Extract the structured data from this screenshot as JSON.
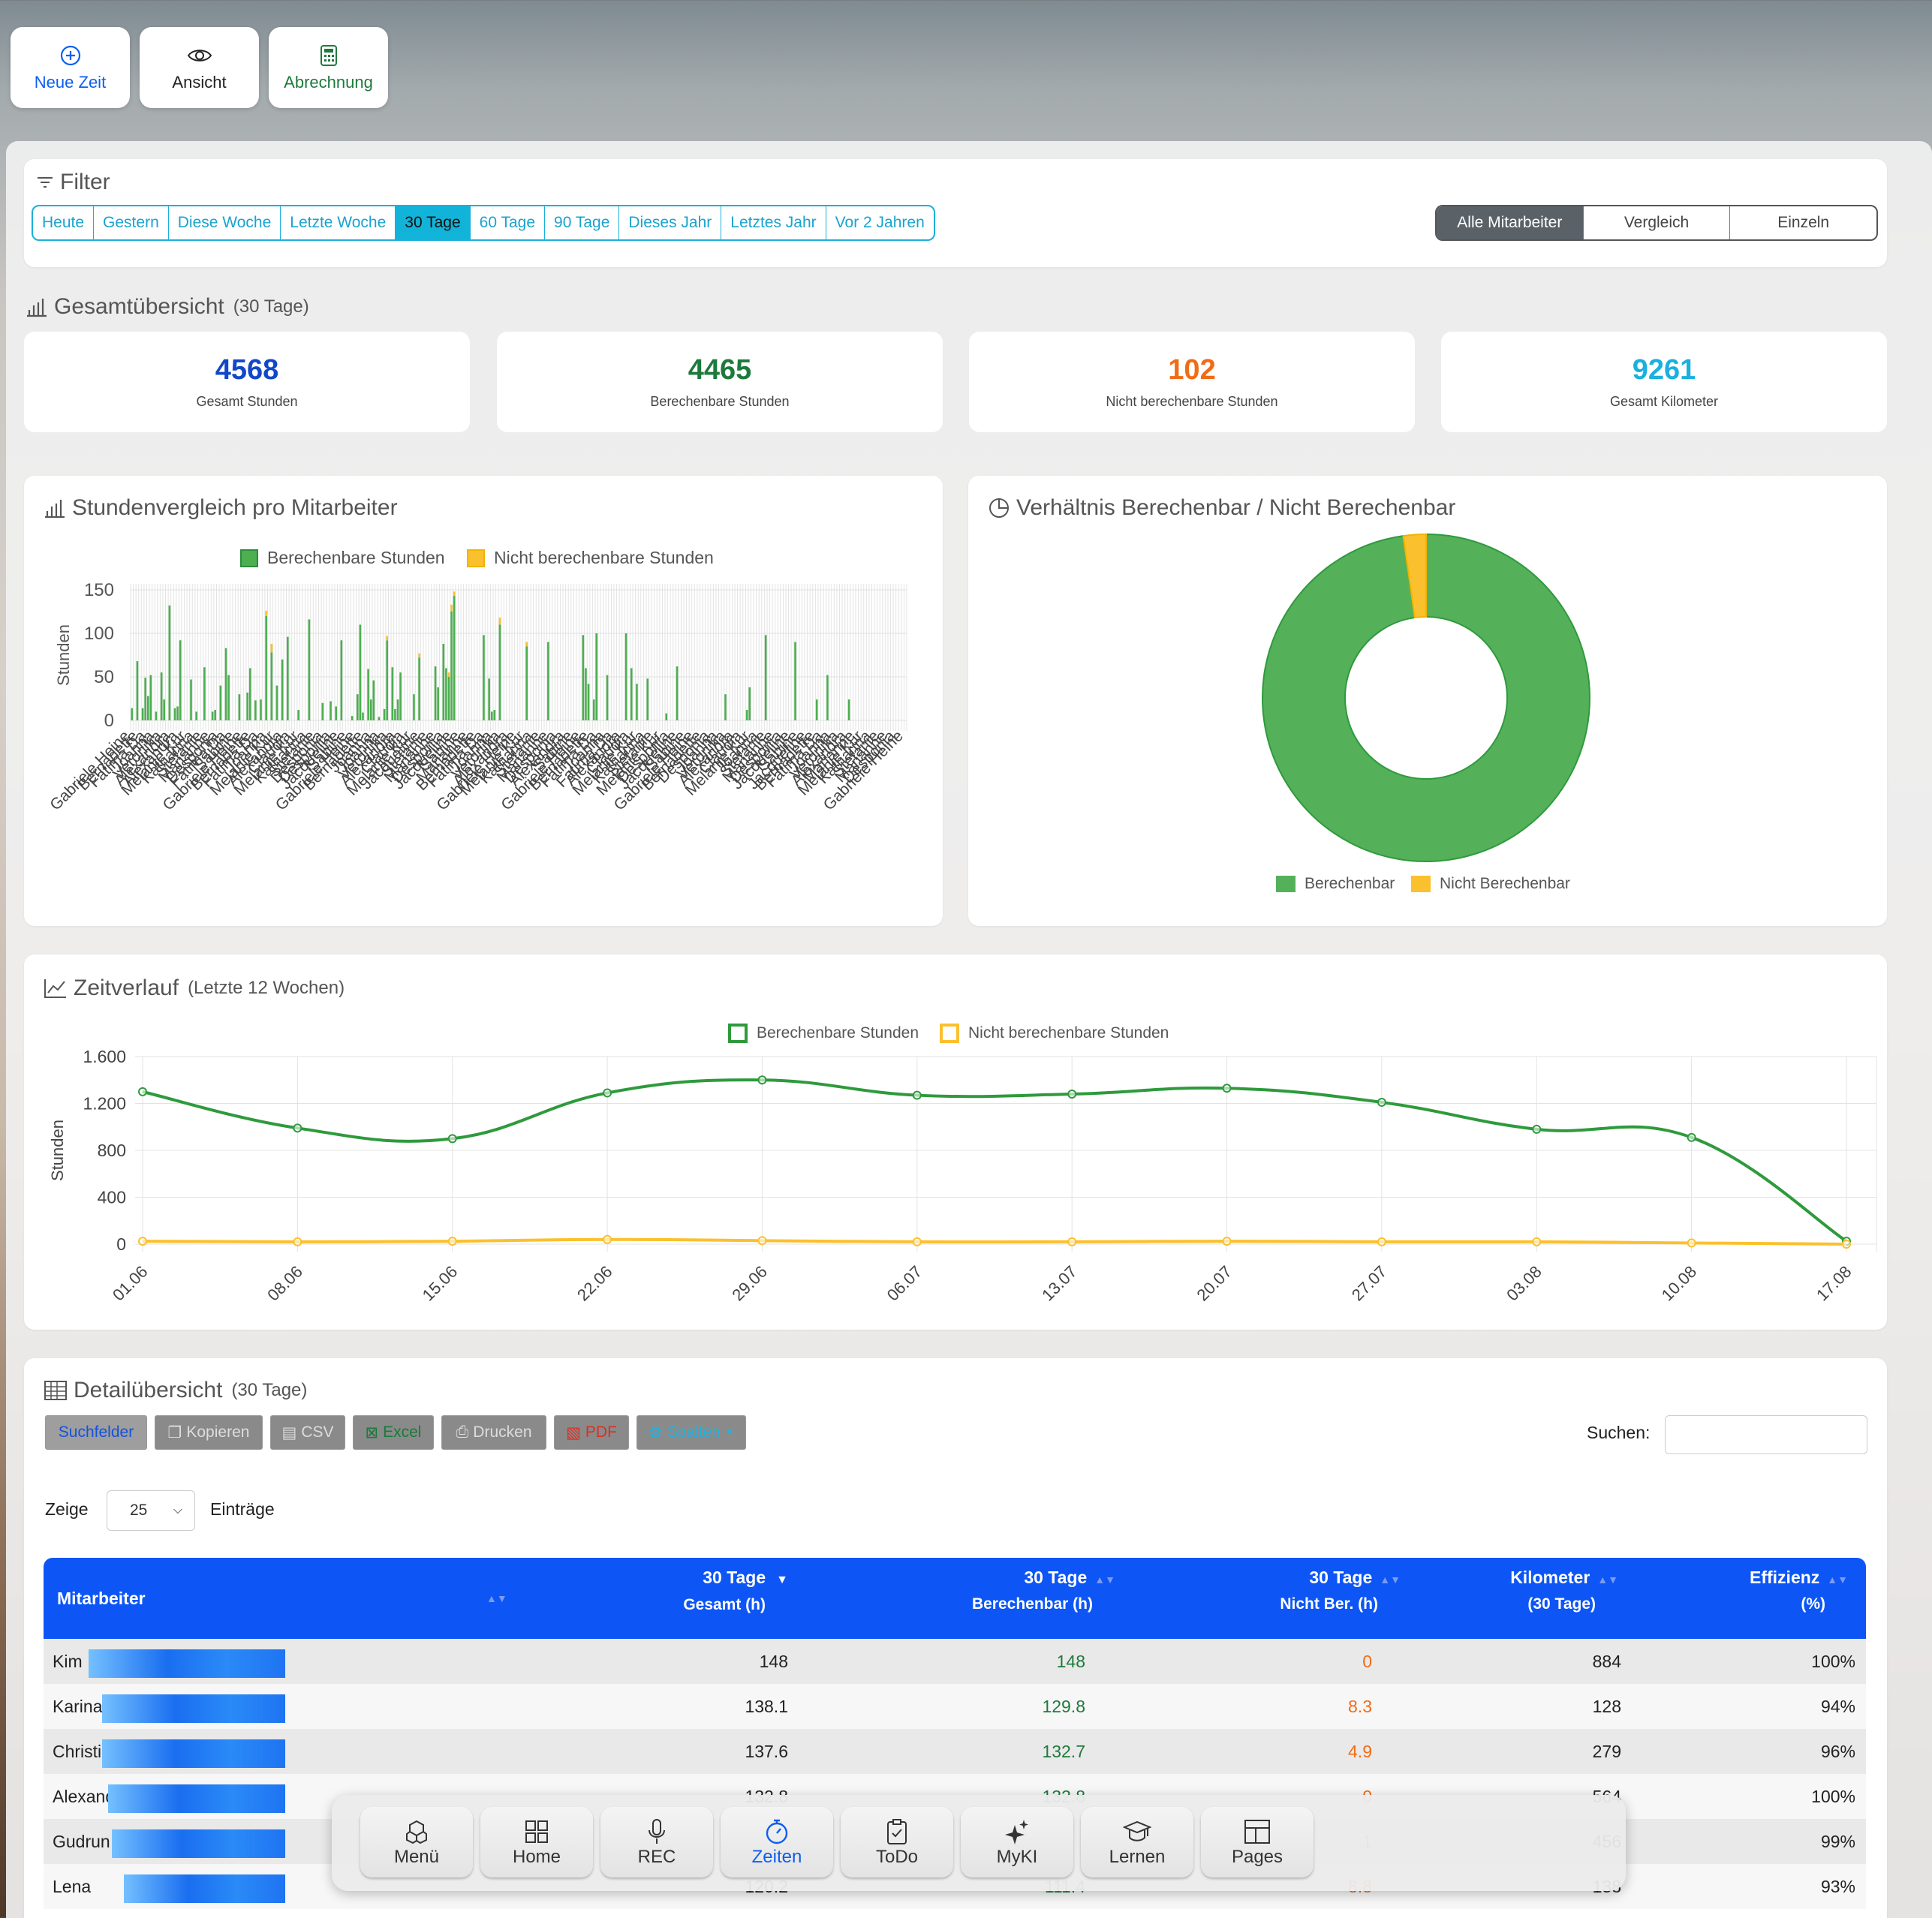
{
  "top_actions": [
    {
      "label": "Neue Zeit",
      "icon": "plus-circle-icon"
    },
    {
      "label": "Ansicht",
      "icon": "eye-icon"
    },
    {
      "label": "Abrechnung",
      "icon": "calculator-icon"
    }
  ],
  "filter": {
    "title": "Filter",
    "ranges": [
      "Heute",
      "Gestern",
      "Diese Woche",
      "Letzte Woche",
      "30 Tage",
      "60 Tage",
      "90 Tage",
      "Dieses Jahr",
      "Letztes Jahr",
      "Vor 2 Jahren"
    ],
    "active_range": "30 Tage",
    "modes": [
      "Alle Mitarbeiter",
      "Vergleich",
      "Einzeln"
    ],
    "active_mode": "Alle Mitarbeiter"
  },
  "overview": {
    "title": "Gesamtübersicht",
    "period": "(30 Tage)",
    "stats": [
      {
        "value": "4568",
        "label": "Gesamt Stunden",
        "color": "#1148c9"
      },
      {
        "value": "4465",
        "label": "Berechenbare Stunden",
        "color": "#1e7a3c"
      },
      {
        "value": "102",
        "label": "Nicht berechenbare Stunden",
        "color": "#f26b15"
      },
      {
        "value": "9261",
        "label": "Gesamt Kilometer",
        "color": "#1ab0e0"
      }
    ]
  },
  "bar_panel": {
    "title": "Stundenvergleich pro Mitarbeiter"
  },
  "pie_panel": {
    "title": "Verhältnis Berechenbar / Nicht Berechenbar"
  },
  "line_panel": {
    "title": "Zeitverlauf",
    "period": "(Letzte 12 Wochen)"
  },
  "chart_data": [
    {
      "type": "bar",
      "stacked": true,
      "ylabel": "Stunden",
      "ylim": [
        0,
        150
      ],
      "yticks": [
        0,
        50,
        100,
        150
      ],
      "series": [
        {
          "name": "Berechenbare Stunden",
          "color": "#4caf50"
        },
        {
          "name": "Nicht berechenbare Stunden",
          "color": "#fbc02d"
        }
      ],
      "category_labels_visible": [
        "Gabriele Heine",
        "Alexandra",
        "Fatima Da",
        "Melanie Kur",
        "Desponia",
        "Joanna",
        "Jacqueline",
        "Marianne"
      ],
      "note_hidden_categories": "tick labels overlap and are illegible",
      "values_billable": [
        14,
        0,
        68,
        0,
        14,
        49,
        28,
        52,
        0,
        10,
        0,
        55,
        24,
        0,
        132,
        0,
        14,
        16,
        92,
        0,
        0,
        0,
        47,
        0,
        10,
        0,
        0,
        61,
        0,
        0,
        10,
        12,
        0,
        40,
        0,
        83,
        52,
        0,
        0,
        0,
        30,
        0,
        0,
        32,
        60,
        0,
        23,
        0,
        24,
        0,
        120,
        0,
        78,
        0,
        40,
        0,
        70,
        0,
        96,
        0,
        0,
        0,
        12,
        0,
        0,
        0,
        116,
        0,
        0,
        0,
        0,
        20,
        0,
        0,
        22,
        0,
        16,
        0,
        92,
        0,
        0,
        0,
        5,
        0,
        30,
        110,
        9,
        0,
        59,
        24,
        46,
        0,
        4,
        0,
        13,
        92,
        0,
        61,
        13,
        24,
        55,
        0,
        0,
        0,
        0,
        30,
        0,
        72,
        0,
        0,
        0,
        0,
        0,
        62,
        38,
        0,
        88,
        60,
        50,
        125,
        143,
        0,
        0,
        0,
        0,
        0,
        0,
        0,
        0,
        0,
        0,
        98,
        0,
        48,
        10,
        12,
        0,
        110,
        0,
        0,
        0,
        0,
        0,
        0,
        0,
        0,
        0,
        85,
        0,
        0,
        0,
        0,
        0,
        0,
        0,
        90,
        0,
        0,
        0,
        0,
        0,
        0,
        0,
        0,
        0,
        0,
        0,
        0,
        98,
        60,
        42,
        0,
        24,
        100,
        0,
        0,
        0,
        52,
        0,
        0,
        0,
        0,
        0,
        0,
        100,
        0,
        60,
        0,
        42,
        0,
        0,
        0,
        48,
        0,
        0,
        0,
        0,
        0,
        0,
        8,
        0,
        0,
        0,
        62,
        0,
        0,
        0,
        0,
        0,
        0,
        0,
        0,
        0,
        0,
        0,
        0,
        0,
        0,
        0,
        0,
        0,
        30,
        0,
        0,
        0,
        0,
        0,
        0,
        0,
        12,
        38,
        0,
        0,
        0,
        0,
        0,
        98,
        0,
        0,
        0,
        0,
        0,
        0,
        0,
        0,
        0,
        0,
        90,
        0,
        0,
        0,
        0,
        0,
        0,
        0,
        24,
        0,
        0,
        0,
        52,
        0,
        0,
        0,
        0,
        0,
        0,
        0,
        24,
        0,
        0,
        0,
        0,
        0,
        0,
        0,
        0,
        0,
        0,
        0,
        0,
        0,
        0,
        0,
        0,
        0,
        0,
        0,
        0,
        0
      ],
      "values_nonbillable": [
        0,
        0,
        0,
        0,
        0,
        0,
        0,
        0,
        0,
        0,
        0,
        0,
        0,
        0,
        0,
        0,
        0,
        0,
        0,
        0,
        0,
        0,
        0,
        0,
        0,
        0,
        0,
        0,
        0,
        0,
        0,
        0,
        0,
        0,
        0,
        0,
        0,
        0,
        0,
        0,
        0,
        0,
        0,
        0,
        0,
        0,
        0,
        0,
        0,
        0,
        6,
        0,
        10,
        0,
        0,
        0,
        0,
        0,
        0,
        0,
        0,
        0,
        0,
        0,
        0,
        0,
        0,
        0,
        0,
        0,
        0,
        0,
        0,
        0,
        0,
        0,
        0,
        0,
        0,
        0,
        0,
        0,
        0,
        0,
        0,
        0,
        0,
        0,
        0,
        0,
        0,
        0,
        0,
        0,
        0,
        5,
        0,
        0,
        0,
        0,
        0,
        0,
        0,
        0,
        0,
        0,
        0,
        5,
        0,
        0,
        0,
        0,
        0,
        0,
        0,
        0,
        0,
        0,
        5,
        8,
        5,
        0,
        0,
        0,
        0,
        0,
        0,
        0,
        0,
        0,
        0,
        0,
        0,
        0,
        0,
        0,
        0,
        8,
        0,
        0,
        0,
        0,
        0,
        0,
        0,
        0,
        0,
        5,
        0,
        0,
        0,
        0,
        0,
        0,
        0,
        0,
        0,
        0,
        0,
        0,
        0,
        0,
        0,
        0,
        0,
        0,
        0,
        0,
        0,
        0,
        0,
        0,
        0,
        0,
        0,
        0,
        0,
        0,
        0,
        0,
        0,
        0,
        0,
        0,
        0,
        0,
        0,
        0,
        0,
        0,
        0,
        0,
        0,
        0,
        0,
        0,
        0,
        0,
        0,
        0,
        0,
        0,
        0,
        0,
        0,
        0,
        0,
        0,
        0,
        0,
        0,
        0,
        0,
        0,
        0,
        0,
        0,
        0,
        0,
        0,
        0,
        0,
        0,
        0,
        0,
        0,
        0,
        0,
        0,
        0,
        0,
        0,
        0,
        0,
        0,
        0,
        0,
        0,
        0,
        0,
        0,
        0,
        0,
        0,
        0,
        0,
        0,
        0,
        0,
        0,
        0,
        0,
        0,
        0,
        0,
        0,
        0,
        0,
        0,
        0,
        0,
        0,
        0,
        0,
        0,
        0,
        0,
        0,
        0,
        0,
        0,
        0,
        0,
        0,
        0,
        0,
        0,
        0,
        0,
        0,
        0,
        0,
        0,
        0
      ]
    },
    {
      "type": "pie",
      "donut": true,
      "series": [
        {
          "name": "Berechenbar",
          "value": 4465,
          "color": "#55b05a"
        },
        {
          "name": "Nicht Berechenbar",
          "value": 102,
          "color": "#fbc02d"
        }
      ],
      "legend": "bottom"
    },
    {
      "type": "line",
      "x": [
        "01.06",
        "08.06",
        "15.06",
        "22.06",
        "29.06",
        "06.07",
        "13.07",
        "20.07",
        "27.07",
        "03.08",
        "10.08",
        "17.08"
      ],
      "ylabel": "Stunden",
      "ylim": [
        0,
        1600
      ],
      "yticks": [
        "0",
        "400",
        "800",
        "1.200",
        "1.600"
      ],
      "series": [
        {
          "name": "Berechenbare Stunden",
          "color": "#2e9a3c",
          "values": [
            1300,
            990,
            900,
            1290,
            1400,
            1270,
            1280,
            1330,
            1210,
            980,
            910,
            25
          ]
        },
        {
          "name": "Nicht berechenbare Stunden",
          "color": "#fbc02d",
          "values": [
            25,
            20,
            25,
            40,
            30,
            20,
            20,
            25,
            20,
            20,
            10,
            0
          ]
        }
      ],
      "legend": "top"
    }
  ],
  "detail": {
    "title": "Detailübersicht",
    "period": "(30 Tage)",
    "buttons": [
      "Suchfelder",
      "Kopieren",
      "CSV",
      "Excel",
      "Drucken",
      "PDF",
      "Spalten"
    ],
    "search_label": "Suchen:",
    "search_value": "",
    "show_label": "Zeige",
    "entries_value": "25",
    "entries_label": "Einträge",
    "columns": [
      {
        "l1": "Mitarbeiter",
        "l2": ""
      },
      {
        "l1": "30 Tage",
        "l2": "Gesamt (h)"
      },
      {
        "l1": "30 Tage",
        "l2": "Berechenbar (h)"
      },
      {
        "l1": "30 Tage",
        "l2": "Nicht Ber. (h)"
      },
      {
        "l1": "Kilometer",
        "l2": "(30 Tage)"
      },
      {
        "l1": "Effizienz",
        "l2": "(%)"
      }
    ],
    "rows": [
      {
        "name": "Kim",
        "total": "148",
        "bill": "148",
        "nonbill": "0",
        "km": "884",
        "eff": "100%",
        "bar": 1.0
      },
      {
        "name": "Karina",
        "total": "138.1",
        "bill": "129.8",
        "nonbill": "8.3",
        "km": "128",
        "eff": "94%",
        "bar": 0.93
      },
      {
        "name": "Christine",
        "total": "137.6",
        "bill": "132.7",
        "nonbill": "4.9",
        "km": "279",
        "eff": "96%",
        "bar": 0.93
      },
      {
        "name": "Alexandra",
        "total": "132.8",
        "bill": "132.8",
        "nonbill": "0",
        "km": "564",
        "eff": "100%",
        "bar": 0.9
      },
      {
        "name": "Gudrun",
        "total": "",
        "bill": "",
        "nonbill": "1",
        "km": "456",
        "eff": "99%",
        "bar": 0.88
      },
      {
        "name": "Lena",
        "total": "120.2",
        "bill": "111.4",
        "nonbill": "8.8",
        "km": "138",
        "eff": "93%",
        "bar": 0.82
      }
    ]
  },
  "dock": [
    {
      "label": "Menü",
      "icon": "cubes-icon"
    },
    {
      "label": "Home",
      "icon": "grid-icon"
    },
    {
      "label": "REC",
      "icon": "microphone-icon"
    },
    {
      "label": "Zeiten",
      "icon": "stopwatch-icon",
      "active": true
    },
    {
      "label": "ToDo",
      "icon": "clipboard-check-icon"
    },
    {
      "label": "MyKI",
      "icon": "sparkles-icon"
    },
    {
      "label": "Lernen",
      "icon": "graduation-cap-icon"
    },
    {
      "label": "Pages",
      "icon": "layout-icon"
    }
  ]
}
